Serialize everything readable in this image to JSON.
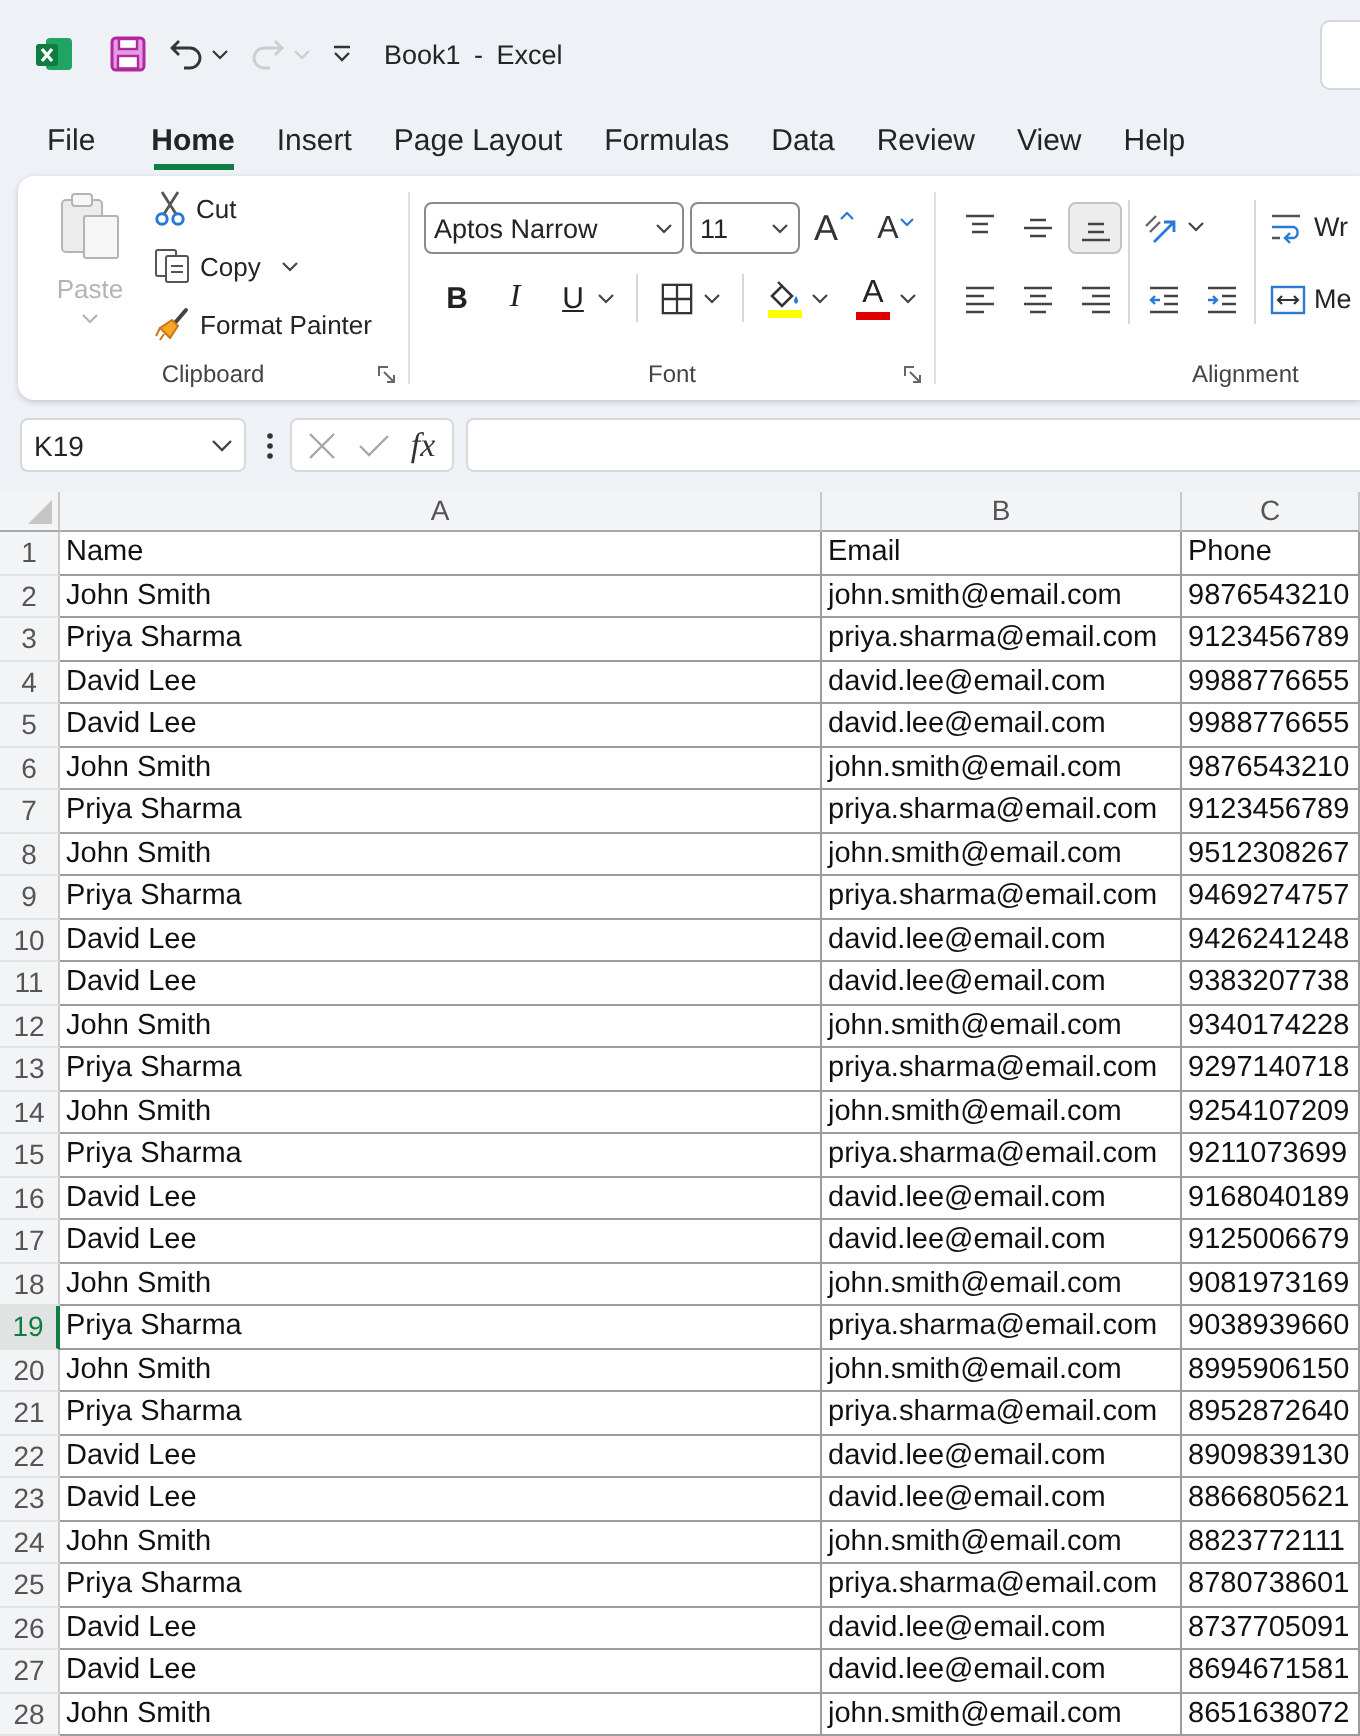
{
  "title_bar": {
    "title": "Book1 - Excel",
    "quick_access": [
      {
        "kind": "save",
        "disabled": false,
        "dropdown": false
      },
      {
        "kind": "undo",
        "disabled": false,
        "dropdown": true
      },
      {
        "kind": "redo",
        "disabled": true,
        "dropdown": true
      },
      {
        "kind": "customize",
        "disabled": false,
        "dropdown": false
      }
    ]
  },
  "tabs": [
    {
      "label": "File",
      "selected": false
    },
    {
      "label": "Home",
      "selected": true
    },
    {
      "label": "Insert",
      "selected": false
    },
    {
      "label": "Page Layout",
      "selected": false
    },
    {
      "label": "Formulas",
      "selected": false
    },
    {
      "label": "Data",
      "selected": false
    },
    {
      "label": "Review",
      "selected": false
    },
    {
      "label": "View",
      "selected": false
    },
    {
      "label": "Help",
      "selected": false
    }
  ],
  "ribbon": {
    "clipboard": {
      "label": "Clipboard",
      "paste": {
        "label": "Paste",
        "disabled": true
      },
      "items": [
        {
          "kind": "cut",
          "label": "Cut",
          "dropdown": false
        },
        {
          "kind": "copy",
          "label": "Copy",
          "dropdown": true
        },
        {
          "kind": "format_painter",
          "label": "Format Painter",
          "dropdown": false
        }
      ]
    },
    "font": {
      "label": "Font",
      "font_name": "Aptos Narrow",
      "font_size": "11",
      "size_buttons": [
        {
          "kind": "grow",
          "glyph": "A"
        },
        {
          "kind": "shrink",
          "glyph": "A"
        }
      ],
      "format_groups": [
        [
          {
            "kind": "bold",
            "glyph": "B",
            "dropdown": false
          },
          {
            "kind": "italic",
            "glyph": "I",
            "dropdown": false
          },
          {
            "kind": "underline",
            "glyph": "U",
            "dropdown": true
          }
        ],
        [
          {
            "kind": "borders",
            "dropdown": true
          }
        ],
        [
          {
            "kind": "fill_color",
            "color": "#ffff00",
            "dropdown": true
          },
          {
            "kind": "font_color",
            "glyph": "A",
            "color": "#e00000",
            "dropdown": true
          }
        ]
      ]
    },
    "alignment": {
      "label": "Alignment",
      "vertical": [
        {
          "kind": "top",
          "selected": false
        },
        {
          "kind": "middle",
          "selected": false
        },
        {
          "kind": "bottom",
          "selected": true
        }
      ],
      "orientation": {
        "dropdown": true
      },
      "horizontal": [
        {
          "kind": "left",
          "selected": false
        },
        {
          "kind": "center",
          "selected": false
        },
        {
          "kind": "right",
          "selected": false
        }
      ],
      "indent": [
        {
          "kind": "decrease"
        },
        {
          "kind": "increase"
        }
      ],
      "wrap_text": {
        "label": "Wr"
      },
      "merge": {
        "label": "Me"
      }
    }
  },
  "formula_bar": {
    "name_box": "K19",
    "function_label": "fx"
  },
  "sheet": {
    "columns": [
      "A",
      "B",
      "C"
    ],
    "rows": [
      {
        "number": "1",
        "selected": false,
        "cells": [
          "Name",
          "Email",
          "Phone"
        ]
      },
      {
        "number": "2",
        "selected": false,
        "cells": [
          "John Smith",
          "john.smith@email.com",
          "9876543210"
        ]
      },
      {
        "number": "3",
        "selected": false,
        "cells": [
          "Priya Sharma",
          "priya.sharma@email.com",
          "9123456789"
        ]
      },
      {
        "number": "4",
        "selected": false,
        "cells": [
          "David Lee",
          "david.lee@email.com",
          "9988776655"
        ]
      },
      {
        "number": "5",
        "selected": false,
        "cells": [
          "David Lee",
          "david.lee@email.com",
          "9988776655"
        ]
      },
      {
        "number": "6",
        "selected": false,
        "cells": [
          "John Smith",
          "john.smith@email.com",
          "9876543210"
        ]
      },
      {
        "number": "7",
        "selected": false,
        "cells": [
          "Priya Sharma",
          "priya.sharma@email.com",
          "9123456789"
        ]
      },
      {
        "number": "8",
        "selected": false,
        "cells": [
          "John Smith",
          "john.smith@email.com",
          "9512308267"
        ]
      },
      {
        "number": "9",
        "selected": false,
        "cells": [
          "Priya Sharma",
          "priya.sharma@email.com",
          "9469274757"
        ]
      },
      {
        "number": "10",
        "selected": false,
        "cells": [
          "David Lee",
          "david.lee@email.com",
          "9426241248"
        ]
      },
      {
        "number": "11",
        "selected": false,
        "cells": [
          "David Lee",
          "david.lee@email.com",
          "9383207738"
        ]
      },
      {
        "number": "12",
        "selected": false,
        "cells": [
          "John Smith",
          "john.smith@email.com",
          "9340174228"
        ]
      },
      {
        "number": "13",
        "selected": false,
        "cells": [
          "Priya Sharma",
          "priya.sharma@email.com",
          "9297140718"
        ]
      },
      {
        "number": "14",
        "selected": false,
        "cells": [
          "John Smith",
          "john.smith@email.com",
          "9254107209"
        ]
      },
      {
        "number": "15",
        "selected": false,
        "cells": [
          "Priya Sharma",
          "priya.sharma@email.com",
          "9211073699"
        ]
      },
      {
        "number": "16",
        "selected": false,
        "cells": [
          "David Lee",
          "david.lee@email.com",
          "9168040189"
        ]
      },
      {
        "number": "17",
        "selected": false,
        "cells": [
          "David Lee",
          "david.lee@email.com",
          "9125006679"
        ]
      },
      {
        "number": "18",
        "selected": false,
        "cells": [
          "John Smith",
          "john.smith@email.com",
          "9081973169"
        ]
      },
      {
        "number": "19",
        "selected": true,
        "cells": [
          "Priya Sharma",
          "priya.sharma@email.com",
          "9038939660"
        ]
      },
      {
        "number": "20",
        "selected": false,
        "cells": [
          "John Smith",
          "john.smith@email.com",
          "8995906150"
        ]
      },
      {
        "number": "21",
        "selected": false,
        "cells": [
          "Priya Sharma",
          "priya.sharma@email.com",
          "8952872640"
        ]
      },
      {
        "number": "22",
        "selected": false,
        "cells": [
          "David Lee",
          "david.lee@email.com",
          "8909839130"
        ]
      },
      {
        "number": "23",
        "selected": false,
        "cells": [
          "David Lee",
          "david.lee@email.com",
          "8866805621"
        ]
      },
      {
        "number": "24",
        "selected": false,
        "cells": [
          "John Smith",
          "john.smith@email.com",
          "8823772111"
        ]
      },
      {
        "number": "25",
        "selected": false,
        "cells": [
          "Priya Sharma",
          "priya.sharma@email.com",
          "8780738601"
        ]
      },
      {
        "number": "26",
        "selected": false,
        "cells": [
          "David Lee",
          "david.lee@email.com",
          "8737705091"
        ]
      },
      {
        "number": "27",
        "selected": false,
        "cells": [
          "David Lee",
          "david.lee@email.com",
          "8694671581"
        ]
      },
      {
        "number": "28",
        "selected": false,
        "cells": [
          "John Smith",
          "john.smith@email.com",
          "8651638072"
        ]
      }
    ]
  }
}
